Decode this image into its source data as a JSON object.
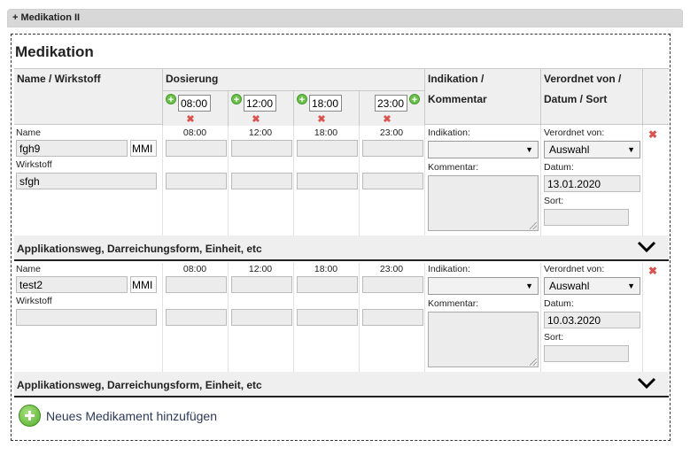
{
  "panel": {
    "title": "+ Medikation II"
  },
  "section_title": "Medikation",
  "headers": {
    "name": "Name / Wirkstoff",
    "dosierung": "Dosierung",
    "indikation_line1": "Indikation /",
    "indikation_line2": "Kommentar",
    "verordnet_line1": "Verordnet von /",
    "verordnet_line2": "Datum / Sort"
  },
  "dose_times": [
    "08:00",
    "12:00",
    "18:00",
    "23:00"
  ],
  "labels": {
    "name": "Name",
    "wirkstoff": "Wirkstoff",
    "mmi": "MMI",
    "indikation": "Indikation:",
    "kommentar": "Kommentar:",
    "verordnet_von": "Verordnet von:",
    "datum": "Datum:",
    "sort": "Sort:",
    "application_bar": "Applikationsweg, Darreichungsform, Einheit, etc"
  },
  "medications": [
    {
      "name": "fgh9",
      "wirkstoff": "sfgh",
      "indikation": "",
      "kommentar": "",
      "verordnet_von": "Auswahl",
      "datum": "13.01.2020",
      "sort": ""
    },
    {
      "name": "test2",
      "wirkstoff": "",
      "indikation": "",
      "kommentar": "",
      "verordnet_von": "Auswahl",
      "datum": "10.03.2020",
      "sort": ""
    }
  ],
  "add_button": {
    "label": "Neues Medikament hinzufügen"
  },
  "icons": {
    "add": "plus-circle-icon",
    "delete": "close-icon",
    "expand": "chevron-down-icon"
  },
  "colors": {
    "add_green": "#54ad2c",
    "delete_red": "#d9534f",
    "header_gray": "#efefef"
  }
}
